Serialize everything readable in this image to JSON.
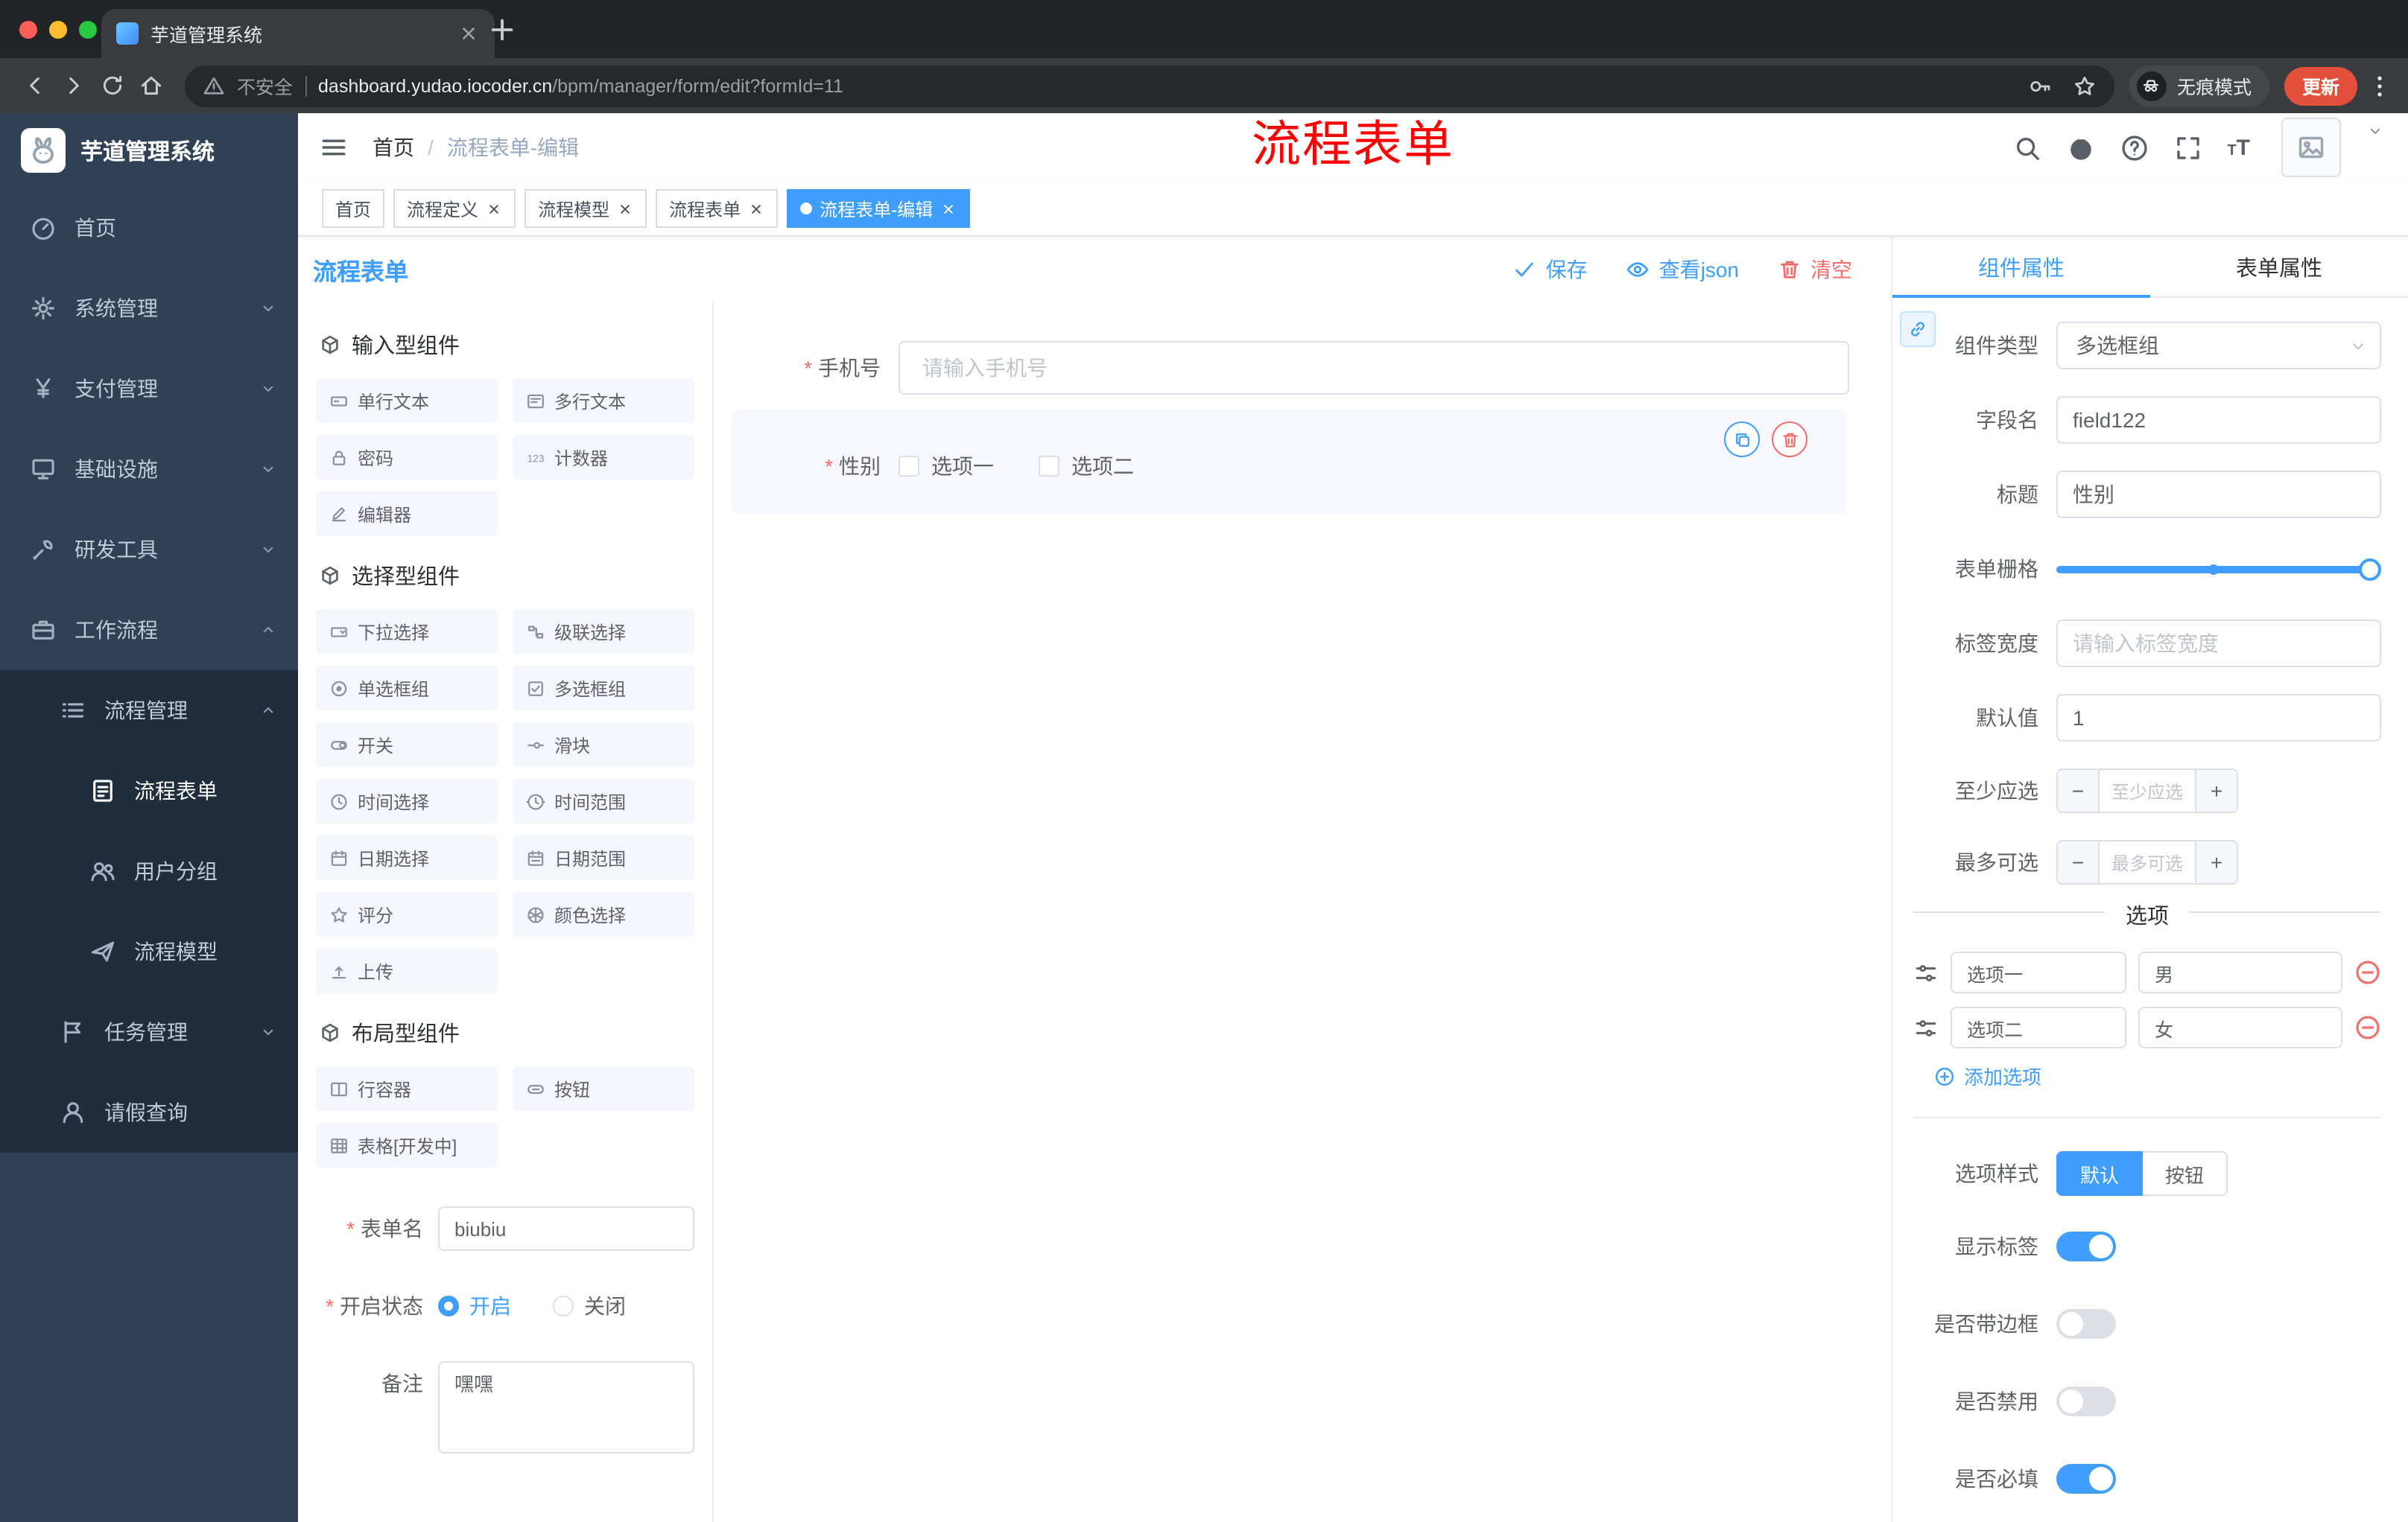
{
  "theme": {
    "primary": "#409EFF",
    "danger": "#F56C6C",
    "annotation_red": "#FF0000",
    "sidebar_bg": "#304156",
    "submenu_bg": "#1F2D3D",
    "active_tag_bg": "#409EFF"
  },
  "browser": {
    "tab_title": "芋道管理系统",
    "security_label": "不安全",
    "url_host": "dashboard.yudao.iocoder.cn",
    "url_path": "/bpm/manager/form/edit?formId=11",
    "incognito_label": "无痕模式",
    "update_label": "更新"
  },
  "sidebar": {
    "logo_title": "芋道管理系统",
    "items": [
      {
        "name": "home",
        "icon": "dashboard",
        "label": "首页",
        "indent": 0
      },
      {
        "name": "system",
        "icon": "gear",
        "label": "系统管理",
        "indent": 0,
        "chevron": "down"
      },
      {
        "name": "payment",
        "icon": "yen",
        "label": "支付管理",
        "indent": 0,
        "chevron": "down"
      },
      {
        "name": "infrastructure",
        "icon": "infra",
        "label": "基础设施",
        "indent": 0,
        "chevron": "down"
      },
      {
        "name": "devtools",
        "icon": "tools",
        "label": "研发工具",
        "indent": 0,
        "chevron": "down"
      },
      {
        "name": "workflow",
        "icon": "briefcase",
        "label": "工作流程",
        "indent": 0,
        "chevron": "up"
      },
      {
        "name": "process-mgmt",
        "icon": "list",
        "label": "流程管理",
        "indent": 1,
        "chevron": "up",
        "submenu": true
      },
      {
        "name": "process-form",
        "icon": "doc",
        "label": "流程表单",
        "indent": 2,
        "submenu": true,
        "active": true
      },
      {
        "name": "user-group",
        "icon": "users",
        "label": "用户分组",
        "indent": 2,
        "submenu": true
      },
      {
        "name": "process-model",
        "icon": "plane",
        "label": "流程模型",
        "indent": 2,
        "submenu": true
      },
      {
        "name": "task-mgmt",
        "icon": "flag",
        "label": "任务管理",
        "indent": 1,
        "chevron": "down",
        "submenu": true
      },
      {
        "name": "leave-query",
        "icon": "user",
        "label": "请假查询",
        "indent": 1,
        "submenu": true
      }
    ]
  },
  "header": {
    "breadcrumb": {
      "home": "首页",
      "separator": "/",
      "current": "流程表单-编辑"
    },
    "annotation": "流程表单"
  },
  "tagbar": {
    "tags": [
      {
        "label": "首页"
      },
      {
        "label": "流程定义",
        "closable": true
      },
      {
        "label": "流程模型",
        "closable": true
      },
      {
        "label": "流程表单",
        "closable": true
      },
      {
        "label": "流程表单-编辑",
        "closable": true,
        "active": true
      }
    ]
  },
  "toolbar": {
    "title": "流程表单",
    "save_label": "保存",
    "view_json_label": "查看json",
    "clear_label": "清空"
  },
  "palette": {
    "groups": [
      {
        "title": "输入型组件",
        "items": [
          {
            "icon": "input",
            "label": "单行文本"
          },
          {
            "icon": "textarea",
            "label": "多行文本"
          },
          {
            "icon": "lock",
            "label": "密码"
          },
          {
            "icon": "num",
            "label": "计数器"
          },
          {
            "icon": "editor",
            "label": "编辑器"
          }
        ]
      },
      {
        "title": "选择型组件",
        "items": [
          {
            "icon": "select",
            "label": "下拉选择"
          },
          {
            "icon": "cascade",
            "label": "级联选择"
          },
          {
            "icon": "radio",
            "label": "单选框组"
          },
          {
            "icon": "checkbox",
            "label": "多选框组"
          },
          {
            "icon": "switch",
            "label": "开关"
          },
          {
            "icon": "slider",
            "label": "滑块"
          },
          {
            "icon": "time",
            "label": "时间选择"
          },
          {
            "icon": "timerange",
            "label": "时间范围"
          },
          {
            "icon": "date",
            "label": "日期选择"
          },
          {
            "icon": "daterange",
            "label": "日期范围"
          },
          {
            "icon": "star",
            "label": "评分"
          },
          {
            "icon": "color",
            "label": "颜色选择"
          },
          {
            "icon": "upload",
            "label": "上传"
          }
        ]
      },
      {
        "title": "布局型组件",
        "items": [
          {
            "icon": "row",
            "label": "行容器"
          },
          {
            "icon": "button",
            "label": "按钮"
          },
          {
            "icon": "table",
            "label": "表格[开发中]"
          }
        ]
      }
    ],
    "form": {
      "name_label": "表单名",
      "name_value": "biubiu",
      "status_label": "开启状态",
      "status_on": "开启",
      "status_off": "关闭",
      "status_value": "开启",
      "remark_label": "备注",
      "remark_value": "嘿嘿"
    }
  },
  "canvas": {
    "phone": {
      "label": "手机号",
      "placeholder": "请输入手机号"
    },
    "gender": {
      "label": "性别",
      "options": [
        "选项一",
        "选项二"
      ]
    }
  },
  "props": {
    "tabs": [
      "组件属性",
      "表单属性"
    ],
    "component_type": {
      "label": "组件类型",
      "value": "多选框组"
    },
    "field_name": {
      "label": "字段名",
      "value": "field122"
    },
    "title": {
      "label": "标题",
      "value": "性别"
    },
    "grid": {
      "label": "表单栅格",
      "percent": 100,
      "mark_percent": 47
    },
    "label_width": {
      "label": "标签宽度",
      "placeholder": "请输入标签宽度"
    },
    "default_value": {
      "label": "默认值",
      "value": "1"
    },
    "min_count": {
      "label": "至少应选",
      "placeholder": "至少应选",
      "decrease": "−",
      "increase": "+"
    },
    "max_count": {
      "label": "最多可选",
      "placeholder": "最多可选",
      "decrease": "−",
      "increase": "+"
    },
    "options_divider": "选项",
    "options": [
      {
        "label": "选项一",
        "value": "男"
      },
      {
        "label": "选项二",
        "value": "女"
      }
    ],
    "add_option_label": "添加选项",
    "option_style": {
      "label": "选项样式",
      "options": [
        "默认",
        "按钮"
      ],
      "active": "默认"
    },
    "switches": [
      {
        "name": "show-label",
        "label": "显示标签",
        "on": true
      },
      {
        "name": "bordered",
        "label": "是否带边框",
        "on": false
      },
      {
        "name": "disabled",
        "label": "是否禁用",
        "on": false
      },
      {
        "name": "required",
        "label": "是否必填",
        "on": true
      }
    ]
  }
}
